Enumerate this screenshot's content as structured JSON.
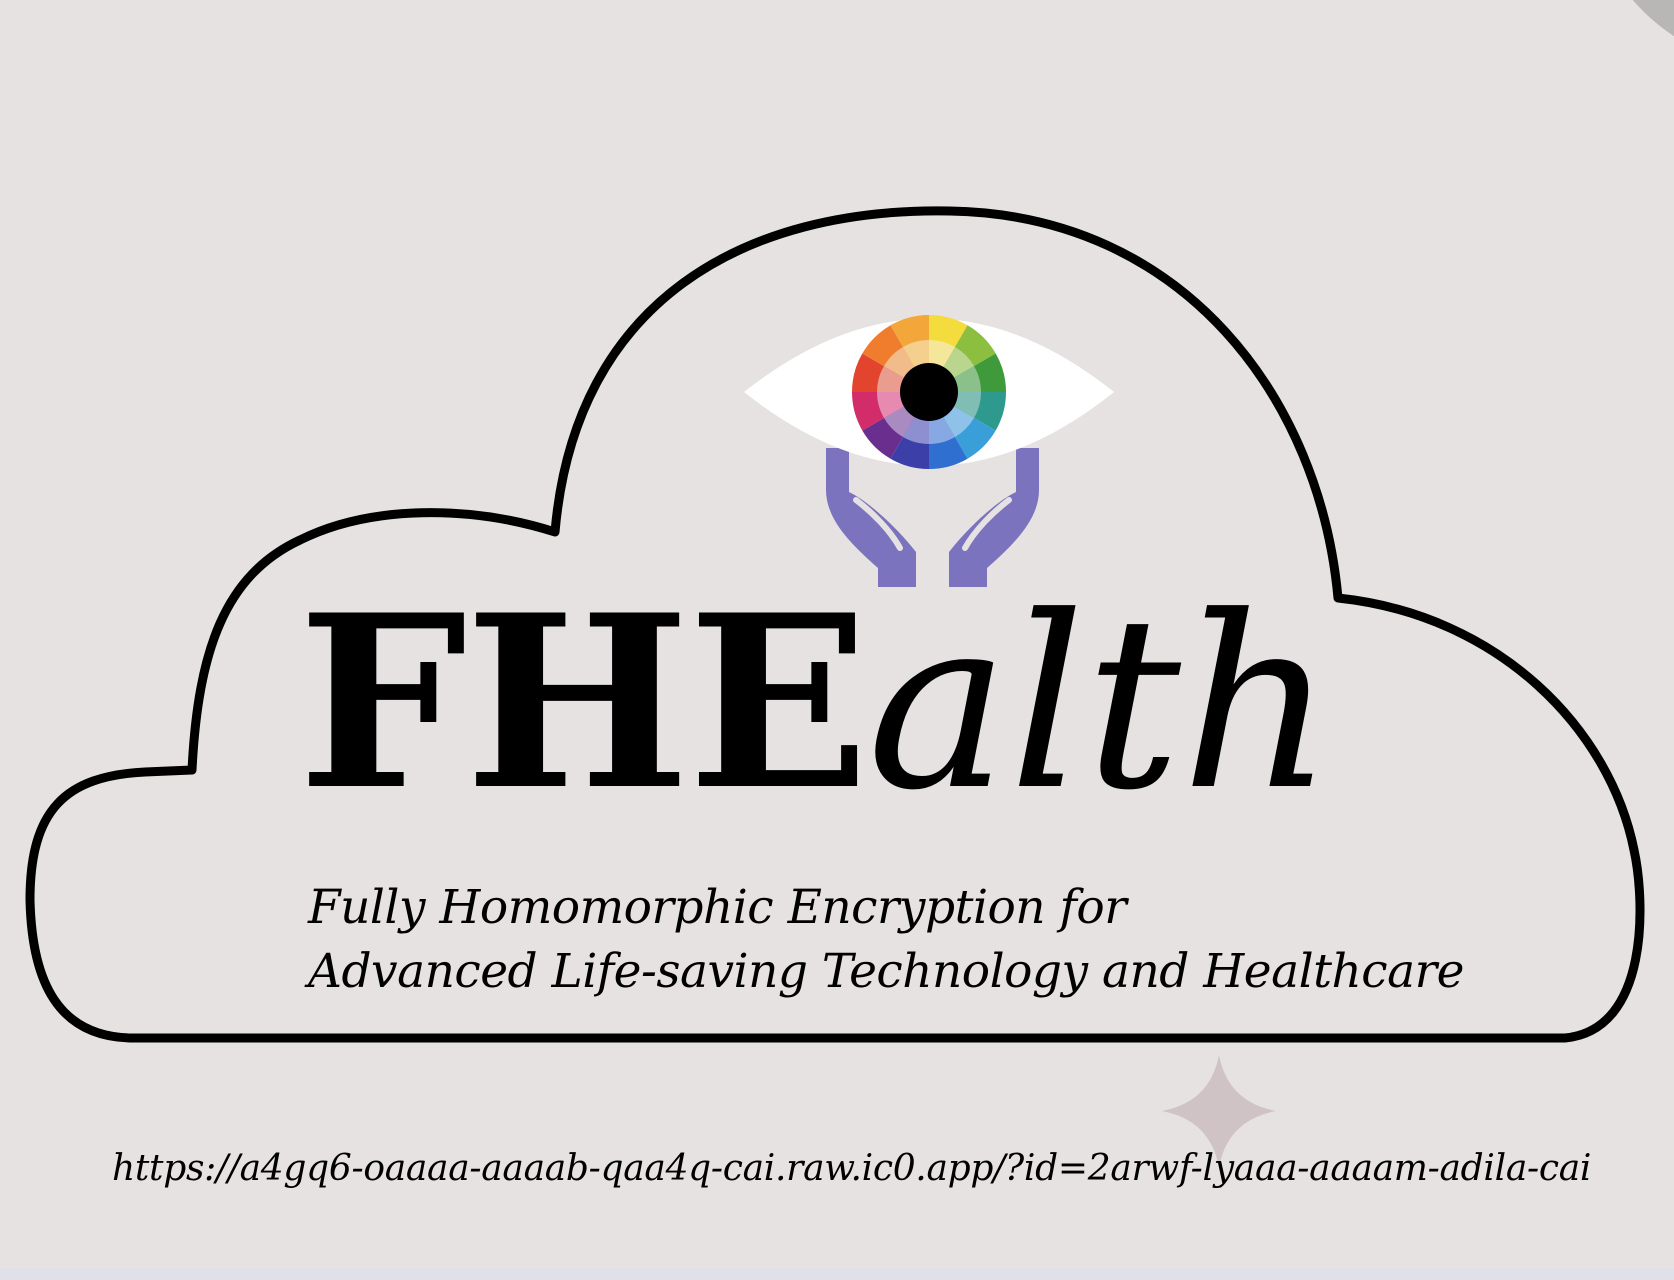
{
  "logo": {
    "title_bold": "FHE",
    "title_italic": "alth",
    "tagline_line1": "Fully Homomorphic Encryption for",
    "tagline_line2": "Advanced Life-saving Technology and Healthcare",
    "icon": "eye-in-hands-icon"
  },
  "url": "https://a4gq6-oaaaa-aaaab-qaa4q-cai.raw.ic0.app/?id=2arwf-lyaaa-aaaam-adila-cai",
  "colors": {
    "background": "#e5e2e1",
    "hands": "#7b73bd",
    "outline": "#000000",
    "sparkle": "#cfc3c5"
  }
}
